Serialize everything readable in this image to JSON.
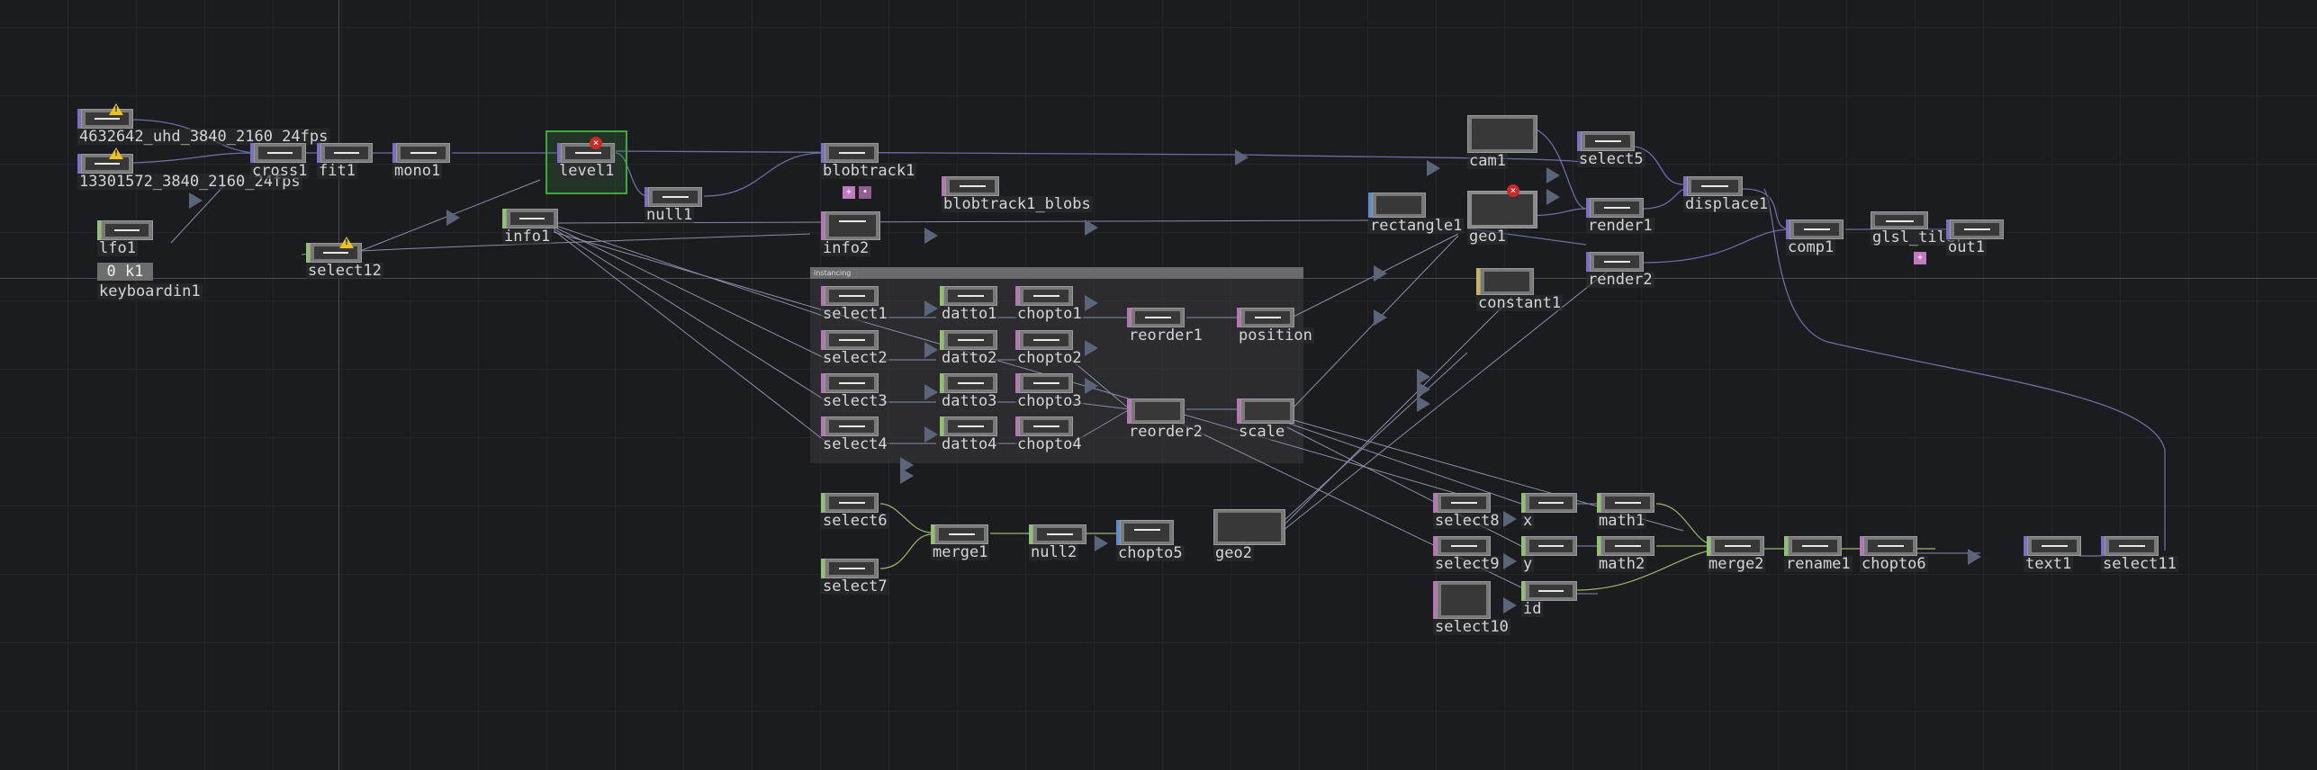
{
  "network_box": {
    "title": "instancing"
  },
  "colors": {
    "top": "#7c6ec0",
    "chop": "#b576b6",
    "dat": "#91c16e",
    "sop": "#5d8dc8",
    "comp": "#c8b35d"
  },
  "keyboardin_value": "0 k1",
  "nodes": {
    "movie1": "4632642_uhd_3840_2160_24fps",
    "movie2": "13301572_3840_2160_24fps",
    "lfo1": "lfo1",
    "keyboardin1": "keyboardin1",
    "select12": "select12",
    "cross1": "cross1",
    "fit1": "fit1",
    "mono1": "mono1",
    "level1": "level1",
    "info1": "info1",
    "null1": "null1",
    "blobtrack1": "blobtrack1",
    "blobtrack1_blobs": "blobtrack1_blobs",
    "info2": "info2",
    "select1": "select1",
    "select2": "select2",
    "select3": "select3",
    "select4": "select4",
    "datto1": "datto1",
    "datto2": "datto2",
    "datto3": "datto3",
    "datto4": "datto4",
    "chopto1": "chopto1",
    "chopto2": "chopto2",
    "chopto3": "chopto3",
    "chopto4": "chopto4",
    "reorder1": "reorder1",
    "reorder2": "reorder2",
    "position": "position",
    "scale": "scale",
    "select6": "select6",
    "select7": "select7",
    "merge1": "merge1",
    "null2": "null2",
    "chopto5": "chopto5",
    "geo2": "geo2",
    "cam1": "cam1",
    "select5": "select5",
    "rectangle1": "rectangle1",
    "geo1": "geo1",
    "constant1": "constant1",
    "render1": "render1",
    "render2": "render2",
    "displace1": "displace1",
    "comp1": "comp1",
    "glsl_tiler": "glsl_tiler",
    "out1": "out1",
    "select8": "select8",
    "select9": "select9",
    "select10": "select10",
    "x": "x",
    "y": "y",
    "id": "id",
    "math1": "math1",
    "math2": "math2",
    "merge2": "merge2",
    "rename1": "rename1",
    "chopto6": "chopto6",
    "text1": "text1",
    "select11": "select11"
  }
}
